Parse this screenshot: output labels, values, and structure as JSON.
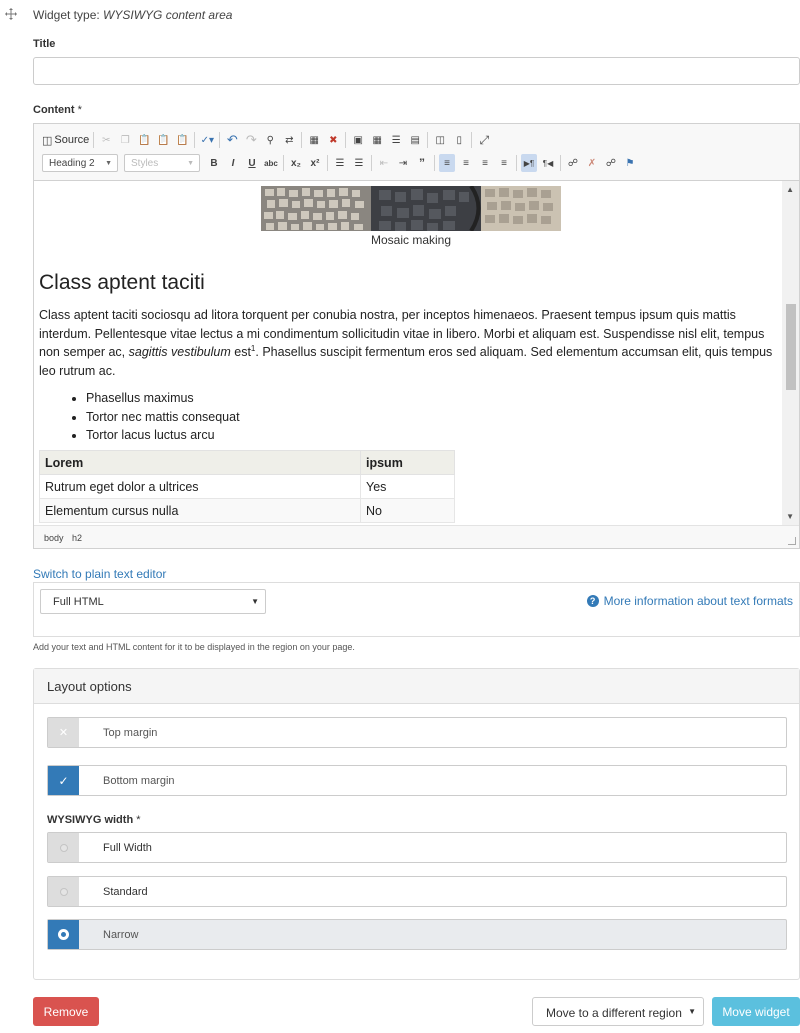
{
  "widget_header": {
    "move_icon": "move-arrows-icon",
    "type_prefix": "Widget type: ",
    "type_name": "WYSIWYG content area"
  },
  "title_field": {
    "label": "Title",
    "value": ""
  },
  "content_field": {
    "label": "Content",
    "required_mark": "*"
  },
  "toolbar": {
    "source_label": "Source",
    "format_combo": "Heading 2",
    "styles_combo": "Styles",
    "row1_icons": [
      "source-icon",
      "cut-icon",
      "copy-icon",
      "paste-icon",
      "paste-text-icon",
      "paste-word-icon",
      "spellcheck-icon",
      "undo-icon",
      "redo-icon",
      "find-icon",
      "replace-icon",
      "select-all-icon",
      "remove-format-icon",
      "image-icon",
      "table-icon",
      "horizontal-rule-icon",
      "template-icon",
      "show-blocks-icon",
      "preview-icon",
      "maximize-icon"
    ],
    "row2_icons": [
      "bold-icon",
      "italic-icon",
      "underline-icon",
      "strikethrough-icon",
      "subscript-icon",
      "superscript-icon",
      "numbered-list-icon",
      "bulleted-list-icon",
      "outdent-icon",
      "indent-icon",
      "blockquote-icon",
      "align-left-icon",
      "align-center-icon",
      "align-right-icon",
      "justify-icon",
      "ltr-icon",
      "rtl-icon",
      "link-icon",
      "unlink-icon",
      "anchor-link-icon",
      "flag-icon"
    ]
  },
  "editor_content": {
    "image_caption": "Mosaic making",
    "heading": "Class aptent taciti",
    "para_part1": "Class aptent taciti sociosqu ad litora torquent per conubia nostra, per inceptos himenaeos. Praesent tempus ipsum quis mattis interdum. Pellentesque vitae lectus a mi condimentum sollicitudin vitae in libero. Morbi et aliquam est. Suspendisse nisl elit, tempus non semper ac, ",
    "para_italic": "sagittis vestibulum",
    "para_part2": " est",
    "para_sup": "1",
    "para_part3": ". Phasellus suscipit fermentum eros sed aliquam. Sed elementum accumsan elit, quis tempus leo rutrum ac.",
    "bullets": [
      "Phasellus maximus",
      "Tortor nec mattis consequat",
      "Tortor lacus luctus arcu"
    ],
    "table": {
      "headers": [
        "Lorem",
        "ipsum"
      ],
      "rows": [
        [
          "Rutrum eget dolor a ultrices",
          "Yes"
        ],
        [
          "Elementum cursus nulla",
          "No"
        ]
      ]
    }
  },
  "statusbar": {
    "crumbs": [
      "body",
      "h2"
    ]
  },
  "switch_link": "Switch to plain text editor",
  "text_format": {
    "selected": "Full HTML",
    "more_info": "More information about text formats",
    "help": "Add your text and HTML content for it to be displayed in the region on your page."
  },
  "layout_options": {
    "heading": "Layout options",
    "top_margin": {
      "label": "Top margin",
      "checked": false
    },
    "bottom_margin": {
      "label": "Bottom margin",
      "checked": true
    },
    "width_label": "WYSIWYG width",
    "width_required": "*",
    "width_options": [
      {
        "label": "Full Width",
        "selected": false
      },
      {
        "label": "Standard",
        "selected": false
      },
      {
        "label": "Narrow",
        "selected": true
      }
    ]
  },
  "footer": {
    "remove": "Remove",
    "region_select": "Move to a different region",
    "move": "Move widget"
  },
  "colors": {
    "link": "#337ab7",
    "danger": "#d9534f",
    "info": "#5bc0de",
    "primary": "#337ab7"
  }
}
